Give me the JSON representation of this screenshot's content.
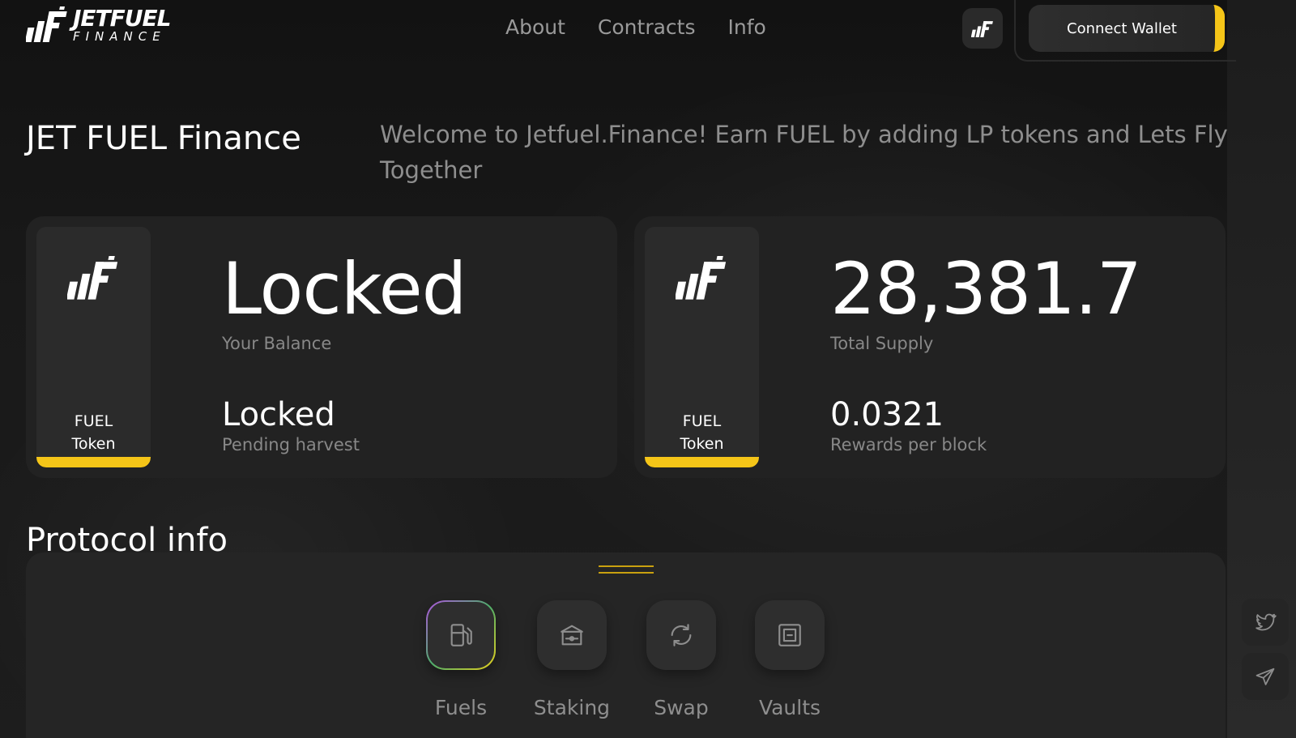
{
  "header": {
    "logo": {
      "main": "JETFUEL",
      "sub": "FINANCE"
    },
    "nav": [
      {
        "label": "About"
      },
      {
        "label": "Contracts"
      },
      {
        "label": "Info"
      }
    ],
    "connect_wallet_label": "Connect Wallet",
    "icon_button": "jetfuel-logo-icon"
  },
  "hero": {
    "title": "JET FUEL Finance",
    "welcome": "Welcome to Jetfuel.Finance! Earn FUEL by adding LP tokens and Lets Fly Together"
  },
  "cards": [
    {
      "token_line1": "FUEL",
      "token_line2": "Token",
      "big_value": "Locked",
      "big_caption": "Your Balance",
      "small_value": "Locked",
      "small_caption": "Pending harvest"
    },
    {
      "token_line1": "FUEL",
      "token_line2": "Token",
      "big_value": "28,381.7",
      "big_caption": "Total Supply",
      "small_value": "0.0321",
      "small_caption": "Rewards per block"
    }
  ],
  "protocol": {
    "title": "Protocol info",
    "tools": [
      {
        "label": "Fuels",
        "icon": "fuel-pump-icon",
        "active": true
      },
      {
        "label": "Staking",
        "icon": "staking-vault-icon",
        "active": false
      },
      {
        "label": "Swap",
        "icon": "swap-icon",
        "active": false
      },
      {
        "label": "Vaults",
        "icon": "safe-icon",
        "active": false
      }
    ]
  },
  "social": [
    {
      "icon": "twitter-icon"
    },
    {
      "icon": "telegram-icon"
    }
  ],
  "colors": {
    "accent": "#f5c518",
    "background": "#161616",
    "card": "#222222"
  }
}
